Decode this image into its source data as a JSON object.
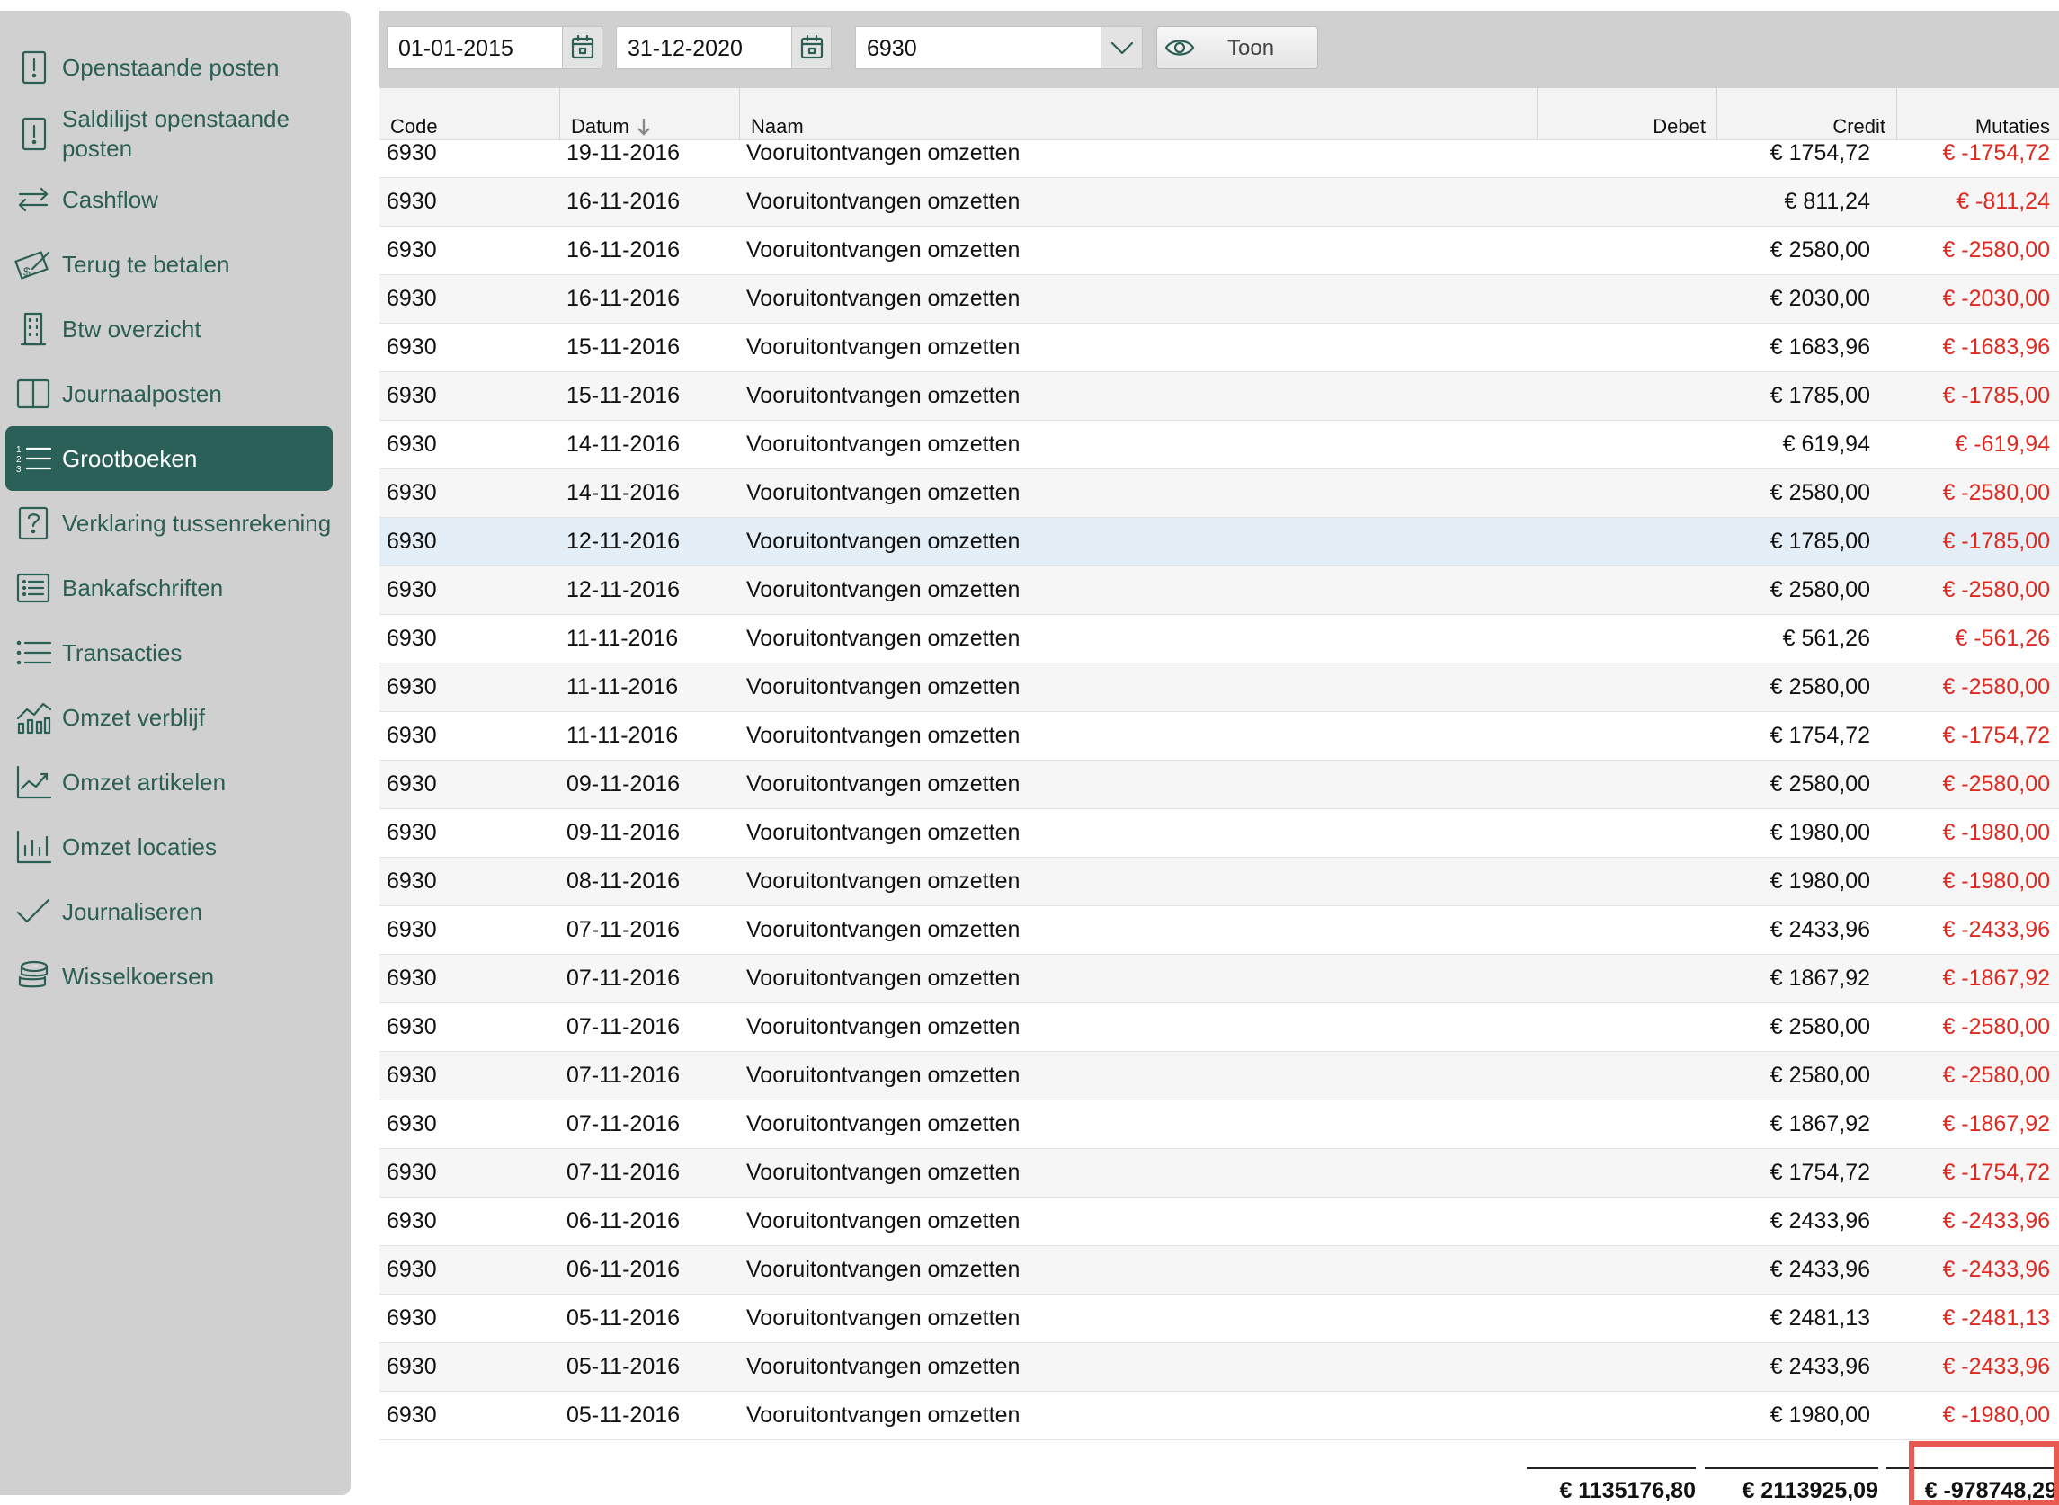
{
  "sidebar": {
    "items": [
      {
        "label": "Openstaande posten",
        "icon": "alert-document-icon",
        "active": false
      },
      {
        "label": "Saldilijst openstaande posten",
        "icon": "alert-document-icon",
        "active": false
      },
      {
        "label": "Cashflow",
        "icon": "transfer-arrows-icon",
        "active": false
      },
      {
        "label": "Terug te betalen",
        "icon": "money-refund-icon",
        "active": false
      },
      {
        "label": "Btw overzicht",
        "icon": "building-icon",
        "active": false
      },
      {
        "label": "Journaalposten",
        "icon": "book-columns-icon",
        "active": false
      },
      {
        "label": "Grootboeken",
        "icon": "numbered-list-icon",
        "active": true
      },
      {
        "label": "Verklaring tussenrekening",
        "icon": "question-box-icon",
        "active": false
      },
      {
        "label": "Bankafschriften",
        "icon": "statement-list-icon",
        "active": false
      },
      {
        "label": "Transacties",
        "icon": "bullet-list-icon",
        "active": false
      },
      {
        "label": "Omzet verblijf",
        "icon": "chart-line-bars-icon",
        "active": false
      },
      {
        "label": "Omzet artikelen",
        "icon": "trend-chart-icon",
        "active": false
      },
      {
        "label": "Omzet locaties",
        "icon": "bar-chart-icon",
        "active": false
      },
      {
        "label": "Journaliseren",
        "icon": "checkmark-icon",
        "active": false
      },
      {
        "label": "Wisselkoersen",
        "icon": "coins-stack-icon",
        "active": false
      }
    ]
  },
  "toolbar": {
    "date_from": "01-01-2015",
    "date_to": "31-12-2020",
    "account": "6930",
    "show_label": "Toon"
  },
  "table": {
    "columns": {
      "code": "Code",
      "date": "Datum",
      "name": "Naam",
      "debit": "Debet",
      "credit": "Credit",
      "mutations": "Mutaties"
    },
    "rows": [
      {
        "code": "6930",
        "date": "19-11-2016",
        "name": "Vooruitontvangen omzetten",
        "credit": "€ 1754,72",
        "mutation": "€ -1754,72"
      },
      {
        "code": "6930",
        "date": "16-11-2016",
        "name": "Vooruitontvangen omzetten",
        "credit": "€ 811,24",
        "mutation": "€ -811,24"
      },
      {
        "code": "6930",
        "date": "16-11-2016",
        "name": "Vooruitontvangen omzetten",
        "credit": "€ 2580,00",
        "mutation": "€ -2580,00"
      },
      {
        "code": "6930",
        "date": "16-11-2016",
        "name": "Vooruitontvangen omzetten",
        "credit": "€ 2030,00",
        "mutation": "€ -2030,00"
      },
      {
        "code": "6930",
        "date": "15-11-2016",
        "name": "Vooruitontvangen omzetten",
        "credit": "€ 1683,96",
        "mutation": "€ -1683,96"
      },
      {
        "code": "6930",
        "date": "15-11-2016",
        "name": "Vooruitontvangen omzetten",
        "credit": "€ 1785,00",
        "mutation": "€ -1785,00"
      },
      {
        "code": "6930",
        "date": "14-11-2016",
        "name": "Vooruitontvangen omzetten",
        "credit": "€ 619,94",
        "mutation": "€ -619,94"
      },
      {
        "code": "6930",
        "date": "14-11-2016",
        "name": "Vooruitontvangen omzetten",
        "credit": "€ 2580,00",
        "mutation": "€ -2580,00"
      },
      {
        "code": "6930",
        "date": "12-11-2016",
        "name": "Vooruitontvangen omzetten",
        "credit": "€ 1785,00",
        "mutation": "€ -1785,00",
        "selected": true
      },
      {
        "code": "6930",
        "date": "12-11-2016",
        "name": "Vooruitontvangen omzetten",
        "credit": "€ 2580,00",
        "mutation": "€ -2580,00"
      },
      {
        "code": "6930",
        "date": "11-11-2016",
        "name": "Vooruitontvangen omzetten",
        "credit": "€ 561,26",
        "mutation": "€ -561,26"
      },
      {
        "code": "6930",
        "date": "11-11-2016",
        "name": "Vooruitontvangen omzetten",
        "credit": "€ 2580,00",
        "mutation": "€ -2580,00"
      },
      {
        "code": "6930",
        "date": "11-11-2016",
        "name": "Vooruitontvangen omzetten",
        "credit": "€ 1754,72",
        "mutation": "€ -1754,72"
      },
      {
        "code": "6930",
        "date": "09-11-2016",
        "name": "Vooruitontvangen omzetten",
        "credit": "€ 2580,00",
        "mutation": "€ -2580,00"
      },
      {
        "code": "6930",
        "date": "09-11-2016",
        "name": "Vooruitontvangen omzetten",
        "credit": "€ 1980,00",
        "mutation": "€ -1980,00"
      },
      {
        "code": "6930",
        "date": "08-11-2016",
        "name": "Vooruitontvangen omzetten",
        "credit": "€ 1980,00",
        "mutation": "€ -1980,00"
      },
      {
        "code": "6930",
        "date": "07-11-2016",
        "name": "Vooruitontvangen omzetten",
        "credit": "€ 2433,96",
        "mutation": "€ -2433,96"
      },
      {
        "code": "6930",
        "date": "07-11-2016",
        "name": "Vooruitontvangen omzetten",
        "credit": "€ 1867,92",
        "mutation": "€ -1867,92"
      },
      {
        "code": "6930",
        "date": "07-11-2016",
        "name": "Vooruitontvangen omzetten",
        "credit": "€ 2580,00",
        "mutation": "€ -2580,00"
      },
      {
        "code": "6930",
        "date": "07-11-2016",
        "name": "Vooruitontvangen omzetten",
        "credit": "€ 2580,00",
        "mutation": "€ -2580,00"
      },
      {
        "code": "6930",
        "date": "07-11-2016",
        "name": "Vooruitontvangen omzetten",
        "credit": "€ 1867,92",
        "mutation": "€ -1867,92"
      },
      {
        "code": "6930",
        "date": "07-11-2016",
        "name": "Vooruitontvangen omzetten",
        "credit": "€ 1754,72",
        "mutation": "€ -1754,72"
      },
      {
        "code": "6930",
        "date": "06-11-2016",
        "name": "Vooruitontvangen omzetten",
        "credit": "€ 2433,96",
        "mutation": "€ -2433,96"
      },
      {
        "code": "6930",
        "date": "06-11-2016",
        "name": "Vooruitontvangen omzetten",
        "credit": "€ 2433,96",
        "mutation": "€ -2433,96"
      },
      {
        "code": "6930",
        "date": "05-11-2016",
        "name": "Vooruitontvangen omzetten",
        "credit": "€ 2481,13",
        "mutation": "€ -2481,13"
      },
      {
        "code": "6930",
        "date": "05-11-2016",
        "name": "Vooruitontvangen omzetten",
        "credit": "€ 2433,96",
        "mutation": "€ -2433,96"
      },
      {
        "code": "6930",
        "date": "05-11-2016",
        "name": "Vooruitontvangen omzetten",
        "credit": "€ 1980,00",
        "mutation": "€ -1980,00"
      }
    ],
    "totals": {
      "debit": "€ 1135176,80",
      "credit": "€ 2113925,09",
      "mutations": "€ -978748,29"
    }
  },
  "colors": {
    "brand": "#2a6057",
    "negative": "#e0281f",
    "highlight": "#e8594f",
    "selected_row": "#e4eef6"
  }
}
